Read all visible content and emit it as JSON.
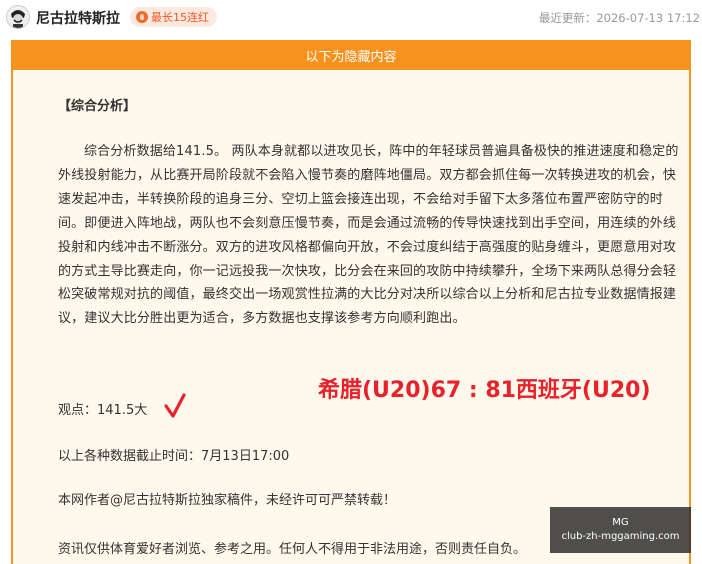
{
  "header": {
    "author_name": "尼古拉特斯拉",
    "badge_label": "最长15连红",
    "updated_label": "最近更新：2026-07-13 17:12"
  },
  "hidden_bar": {
    "label": "以下为隐藏内容"
  },
  "article": {
    "section_heading": "【综合分析】",
    "analysis_paragraph": "综合分析数据给141.5。 两队本身就都以进攻见长，阵中的年轻球员普遍具备极快的推进速度和稳定的外线投射能力，从比赛开局阶段就不会陷入慢节奏的磨阵地僵局。双方都会抓住每一次转换进攻的机会，快速发起冲击，半转换阶段的追身三分、空切上篮会接连出现，不会给对手留下太多落位布置严密防守的时间。即便进入阵地战，两队也不会刻意压慢节奏，而是会通过流畅的传导快速找到出手空间，用连续的外线投射和内线冲击不断涨分。双方的进攻风格都偏向开放，不会过度纠结于高强度的贴身缠斗，更愿意用对攻的方式主导比赛走向，你一记远投我一次快攻，比分会在来回的攻防中持续攀升，全场下来两队总得分会轻松突破常规对抗的阈值，最终交出一场观赏性拉满的大比分对决所以综合以上分析和尼古拉专业数据情报建议，建议大比分胜出更为适合，多方数据也支撑该参考方向顺利跑出。",
    "result_overlay": "希腊(U20)67 : 81西班牙(U20)",
    "viewpoint": "观点：141.5大",
    "deadline": "以上各种数据截止时间：7月13日17:00",
    "copyright": "本网作者@尼古拉特斯拉独家稿件，未经许可可严禁转载！",
    "disclaimer": "资讯仅供体育爱好者浏览、参考之用。任何人不得用于非法用途，否则责任自负。"
  },
  "watermark": {
    "line1": "MG",
    "line2": "club-zh-mggaming.com"
  },
  "colors": {
    "accent_orange": "#f7921e",
    "content_background": "#fff8ec",
    "result_red": "#e8212a",
    "badge_text": "#f15a24"
  },
  "icons": {
    "avatar": "avatar-portrait",
    "badge": "flame-icon",
    "check": "check-mark-icon"
  }
}
